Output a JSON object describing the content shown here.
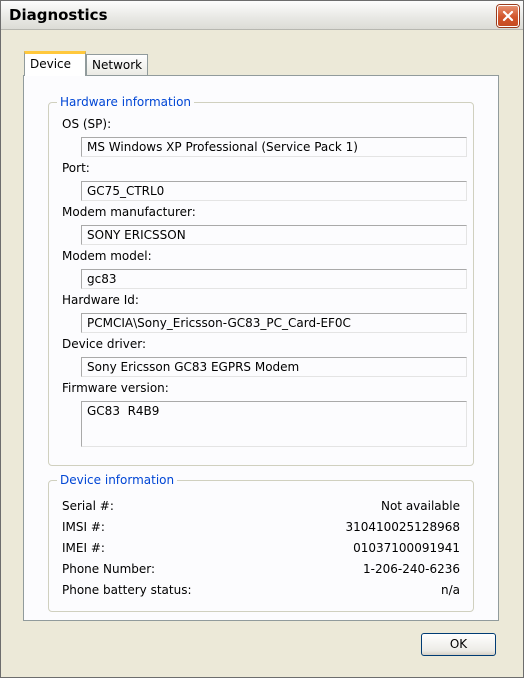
{
  "window": {
    "title": "Diagnostics",
    "close_symbol": "✕"
  },
  "tabs": [
    {
      "label": "Device",
      "active": true
    },
    {
      "label": "Network",
      "active": false
    }
  ],
  "hardware": {
    "title": "Hardware information",
    "fields": [
      {
        "label": "OS (SP):",
        "value": "MS Windows XP Professional (Service Pack 1)"
      },
      {
        "label": "Port:",
        "value": "GC75_CTRL0"
      },
      {
        "label": "Modem manufacturer:",
        "value": "SONY ERICSSON"
      },
      {
        "label": "Modem model:",
        "value": "gc83"
      },
      {
        "label": "Hardware Id:",
        "value": "PCMCIA\\Sony_Ericsson-GC83_PC_Card-EF0C"
      },
      {
        "label": "Device driver:",
        "value": "Sony Ericsson GC83 EGPRS Modem"
      },
      {
        "label": "Firmware version:",
        "value": "GC83  R4B9"
      }
    ]
  },
  "device_info": {
    "title": "Device information",
    "rows": [
      {
        "label": "Serial #:",
        "value": "Not available"
      },
      {
        "label": "IMSI #:",
        "value": "310410025128968"
      },
      {
        "label": "IMEI #:",
        "value": "01037100091941"
      },
      {
        "label": "Phone Number:",
        "value": "1-206-240-6236"
      },
      {
        "label": "Phone battery status:",
        "value": "n/a"
      }
    ]
  },
  "buttons": {
    "ok": "OK"
  },
  "colors": {
    "group_title": "#0046d5",
    "active_tab_accent": "#ffc83c",
    "close_button": "#d2552b"
  }
}
